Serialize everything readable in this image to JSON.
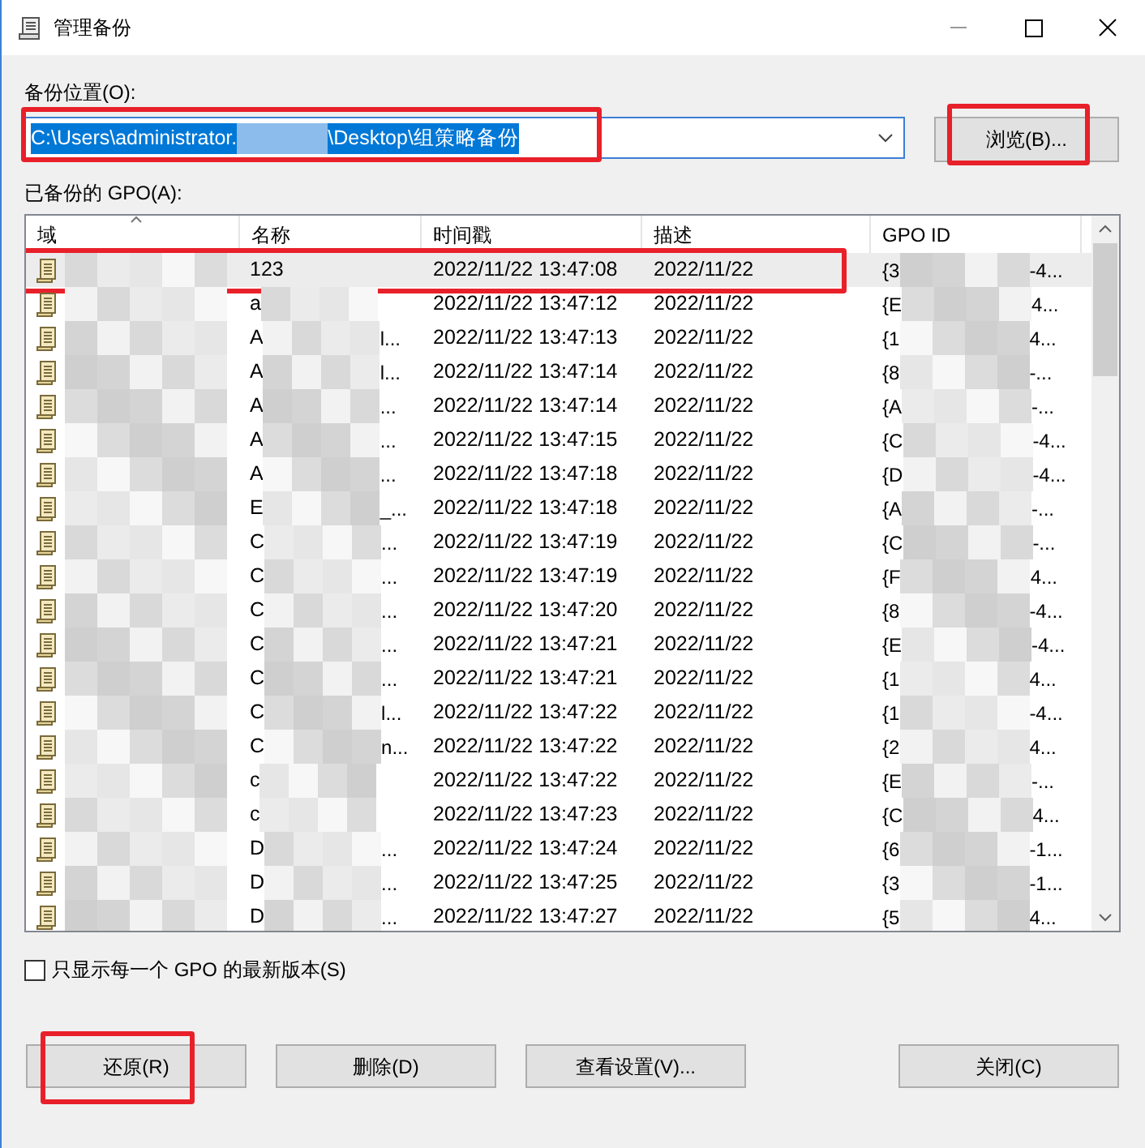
{
  "window": {
    "title": "管理备份"
  },
  "location": {
    "label": "备份位置(O):",
    "value_start": "C:\\Users\\administrator.",
    "value_end": "\\Desktop\\组策略备份",
    "text_selected": true,
    "highlighted": true
  },
  "browse_button": {
    "label": "浏览(B)...",
    "highlighted": true
  },
  "list": {
    "label": "已备份的 GPO(A):",
    "columns": [
      "域",
      "名称",
      "时间戳",
      "描述",
      "GPO ID"
    ],
    "rows": [
      {
        "selected": true,
        "highlighted": true,
        "name_start": "123",
        "name_end": "",
        "time": "2022/11/22 13:47:08",
        "desc": "2022/11/22",
        "id_start": "{3",
        "id_end": "-4..."
      },
      {
        "selected": false,
        "highlighted": false,
        "name_start": "a",
        "name_end": "",
        "time": "2022/11/22 13:47:12",
        "desc": "2022/11/22",
        "id_start": "{E",
        "id_end": "4..."
      },
      {
        "selected": false,
        "highlighted": false,
        "name_start": "A",
        "name_end": "l...",
        "time": "2022/11/22 13:47:13",
        "desc": "2022/11/22",
        "id_start": "{1",
        "id_end": "4..."
      },
      {
        "selected": false,
        "highlighted": false,
        "name_start": "A",
        "name_end": "l...",
        "time": "2022/11/22 13:47:14",
        "desc": "2022/11/22",
        "id_start": "{8",
        "id_end": "-..."
      },
      {
        "selected": false,
        "highlighted": false,
        "name_start": "A",
        "name_end": "...",
        "time": "2022/11/22 13:47:14",
        "desc": "2022/11/22",
        "id_start": "{A",
        "id_end": "-..."
      },
      {
        "selected": false,
        "highlighted": false,
        "name_start": "A",
        "name_end": "...",
        "time": "2022/11/22 13:47:15",
        "desc": "2022/11/22",
        "id_start": "{C",
        "id_end": "-4..."
      },
      {
        "selected": false,
        "highlighted": false,
        "name_start": "A",
        "name_end": "...",
        "time": "2022/11/22 13:47:18",
        "desc": "2022/11/22",
        "id_start": "{D",
        "id_end": "-4..."
      },
      {
        "selected": false,
        "highlighted": false,
        "name_start": "E",
        "name_end": "_...",
        "time": "2022/11/22 13:47:18",
        "desc": "2022/11/22",
        "id_start": "{A",
        "id_end": "-..."
      },
      {
        "selected": false,
        "highlighted": false,
        "name_start": "C",
        "name_end": "...",
        "time": "2022/11/22 13:47:19",
        "desc": "2022/11/22",
        "id_start": "{C",
        "id_end": "-..."
      },
      {
        "selected": false,
        "highlighted": false,
        "name_start": "C",
        "name_end": "...",
        "time": "2022/11/22 13:47:19",
        "desc": "2022/11/22",
        "id_start": "{F",
        "id_end": "4..."
      },
      {
        "selected": false,
        "highlighted": false,
        "name_start": "C",
        "name_end": "...",
        "time": "2022/11/22 13:47:20",
        "desc": "2022/11/22",
        "id_start": "{8",
        "id_end": "-4..."
      },
      {
        "selected": false,
        "highlighted": false,
        "name_start": "C",
        "name_end": "...",
        "time": "2022/11/22 13:47:21",
        "desc": "2022/11/22",
        "id_start": "{E",
        "id_end": "-4..."
      },
      {
        "selected": false,
        "highlighted": false,
        "name_start": "C",
        "name_end": "...",
        "time": "2022/11/22 13:47:21",
        "desc": "2022/11/22",
        "id_start": "{1",
        "id_end": "4..."
      },
      {
        "selected": false,
        "highlighted": false,
        "name_start": "C",
        "name_end": "l...",
        "time": "2022/11/22 13:47:22",
        "desc": "2022/11/22",
        "id_start": "{1",
        "id_end": "-4..."
      },
      {
        "selected": false,
        "highlighted": false,
        "name_start": "C",
        "name_end": "n...",
        "time": "2022/11/22 13:47:22",
        "desc": "2022/11/22",
        "id_start": "{2",
        "id_end": "4..."
      },
      {
        "selected": false,
        "highlighted": false,
        "name_start": "c",
        "name_end": "",
        "time": "2022/11/22 13:47:22",
        "desc": "2022/11/22",
        "id_start": "{E",
        "id_end": "-..."
      },
      {
        "selected": false,
        "highlighted": false,
        "name_start": "c",
        "name_end": "",
        "time": "2022/11/22 13:47:23",
        "desc": "2022/11/22",
        "id_start": "{C",
        "id_end": "4..."
      },
      {
        "selected": false,
        "highlighted": false,
        "name_start": "D",
        "name_end": "...",
        "time": "2022/11/22 13:47:24",
        "desc": "2022/11/22",
        "id_start": "{6",
        "id_end": "-1..."
      },
      {
        "selected": false,
        "highlighted": false,
        "name_start": "D",
        "name_end": "...",
        "time": "2022/11/22 13:47:25",
        "desc": "2022/11/22",
        "id_start": "{3",
        "id_end": "-1..."
      },
      {
        "selected": false,
        "highlighted": false,
        "name_start": "D",
        "name_end": "...",
        "time": "2022/11/22 13:47:27",
        "desc": "2022/11/22",
        "id_start": "{5",
        "id_end": "4..."
      }
    ]
  },
  "latest_only": {
    "label": "只显示每一个 GPO 的最新版本(S)",
    "checked": false
  },
  "buttons": [
    {
      "label": "还原(R)",
      "highlighted": true
    },
    {
      "label": "删除(D)",
      "highlighted": false
    },
    {
      "label": "查看设置(V)...",
      "highlighted": false
    },
    {
      "label": "关闭(C)",
      "highlighted": false
    }
  ]
}
